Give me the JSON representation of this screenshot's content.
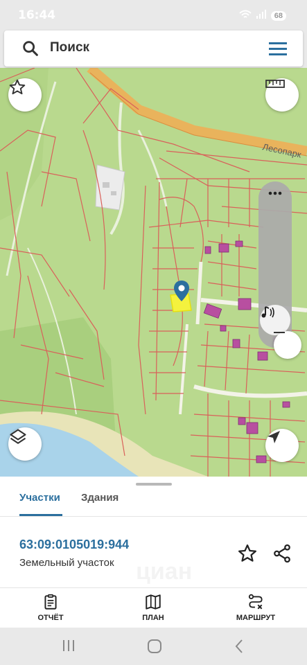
{
  "status_bar": {
    "time": "16:44",
    "battery": "68"
  },
  "search": {
    "placeholder": "Поиск"
  },
  "map": {
    "road_label": "Лесопарк",
    "icons": [
      "star-icon",
      "ruler-icon",
      "layers-icon",
      "location-arrow-icon",
      "location-pin-icon",
      "more-icon",
      "sound-icon",
      "zoom-out-icon"
    ]
  },
  "tabs": [
    {
      "label": "Участки",
      "active": true
    },
    {
      "label": "Здания",
      "active": false
    }
  ],
  "parcel": {
    "cadastral_number": "63:09:0105019:944",
    "type": "Земельный участок"
  },
  "actions": [
    {
      "label": "ОТЧЁТ",
      "icon": "clipboard-icon"
    },
    {
      "label": "ПЛАН",
      "icon": "map-icon"
    },
    {
      "label": "МАРШРУТ",
      "icon": "route-icon"
    }
  ],
  "watermark": "циан",
  "colors": {
    "accent": "#2b6f9e",
    "map_green": "#b9d98e",
    "parcel_border": "#d9605a",
    "selected_parcel": "#f4f23e",
    "water": "#a9d3ea"
  }
}
